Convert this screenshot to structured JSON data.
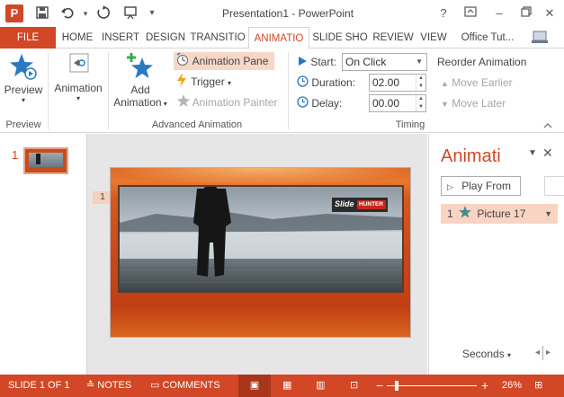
{
  "app": {
    "title": "Presentation1 - PowerPoint",
    "logo_letter": "P",
    "accent": "#d24726"
  },
  "titlebar": {
    "help": "?",
    "minimize": "–",
    "close": "✕"
  },
  "tabs": [
    {
      "label": "FILE"
    },
    {
      "label": "HOME"
    },
    {
      "label": "INSERT"
    },
    {
      "label": "DESIGN"
    },
    {
      "label": "TRANSITIO"
    },
    {
      "label": "ANIMATIO"
    },
    {
      "label": "SLIDE SHO"
    },
    {
      "label": "REVIEW"
    },
    {
      "label": "VIEW"
    },
    {
      "label": "Office Tut..."
    }
  ],
  "ribbon": {
    "preview": {
      "label": "Preview",
      "group": "Preview"
    },
    "animation": {
      "label": "Animation"
    },
    "add_animation": {
      "label_line1": "Add",
      "label_line2": "Animation"
    },
    "animation_pane": "Animation Pane",
    "trigger": "Trigger",
    "animation_painter": "Animation Painter",
    "advanced_group": "Advanced Animation",
    "timing": {
      "start_label": "Start:",
      "start_value": "On Click",
      "duration_label": "Duration:",
      "duration_value": "02.00",
      "delay_label": "Delay:",
      "delay_value": "00.00",
      "reorder_label": "Reorder Animation",
      "move_earlier": "Move Earlier",
      "move_later": "Move Later",
      "group": "Timing"
    }
  },
  "thumbnails": [
    {
      "number": "1"
    }
  ],
  "slide": {
    "anim_marker": "1",
    "logo_text_1": "Slide",
    "logo_text_2": "HUNTER"
  },
  "animation_pane": {
    "title": "Animati",
    "play_from": "Play From",
    "items": [
      {
        "number": "1",
        "label": "Picture 17"
      }
    ],
    "seconds": "Seconds"
  },
  "statusbar": {
    "slide_info": "SLIDE 1 OF 1",
    "notes": "NOTES",
    "comments": "COMMENTS",
    "zoom": "26%"
  }
}
